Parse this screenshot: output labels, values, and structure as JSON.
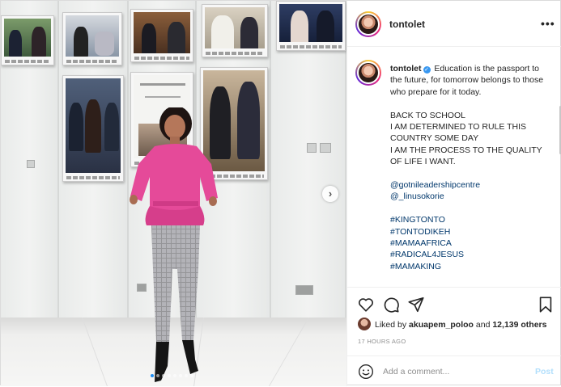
{
  "post": {
    "username": "tontolet",
    "caption": {
      "username": "tontolet",
      "intro": "Education is the passport to the future, for tomorrow belongs to those who prepare for it today.",
      "lines": [
        "BACK TO SCHOOL",
        "I AM DETERMINED TO RULE THIS COUNTRY SOME DAY",
        "I AM THE PROCESS TO THE QUALITY OF LIFE I WANT."
      ],
      "mentions": [
        "@gotnileadershipcentre",
        "@_linusokorie"
      ],
      "hashtags": [
        "#KINGTONTO",
        "#TONTODIKEH",
        "#MAMAAFRICA",
        "#RADICAL4JESUS",
        "#MAMAKING"
      ]
    },
    "liked_by": {
      "prefix": "Liked by",
      "user": "akuapem_poloo",
      "connector": "and",
      "others": "12,139 others"
    },
    "timestamp": "17 HOURS AGO",
    "comment": {
      "placeholder": "Add a comment...",
      "post_label": "Post"
    },
    "carousel": {
      "total": 8,
      "active_index": 0
    }
  },
  "icons": {
    "more": "more-options-icon",
    "like": "heart-icon",
    "comment": "comment-icon",
    "share": "paper-plane-icon",
    "save": "bookmark-icon",
    "emoji": "emoji-icon",
    "next": "chevron-right-icon",
    "verified": "verified-badge-icon"
  },
  "colors": {
    "link": "#00376b",
    "verified": "#3897f0",
    "post_button_disabled": "#b2dffc",
    "muted": "#8e8e8e",
    "carousel_active_dot": "#1e8df2"
  }
}
